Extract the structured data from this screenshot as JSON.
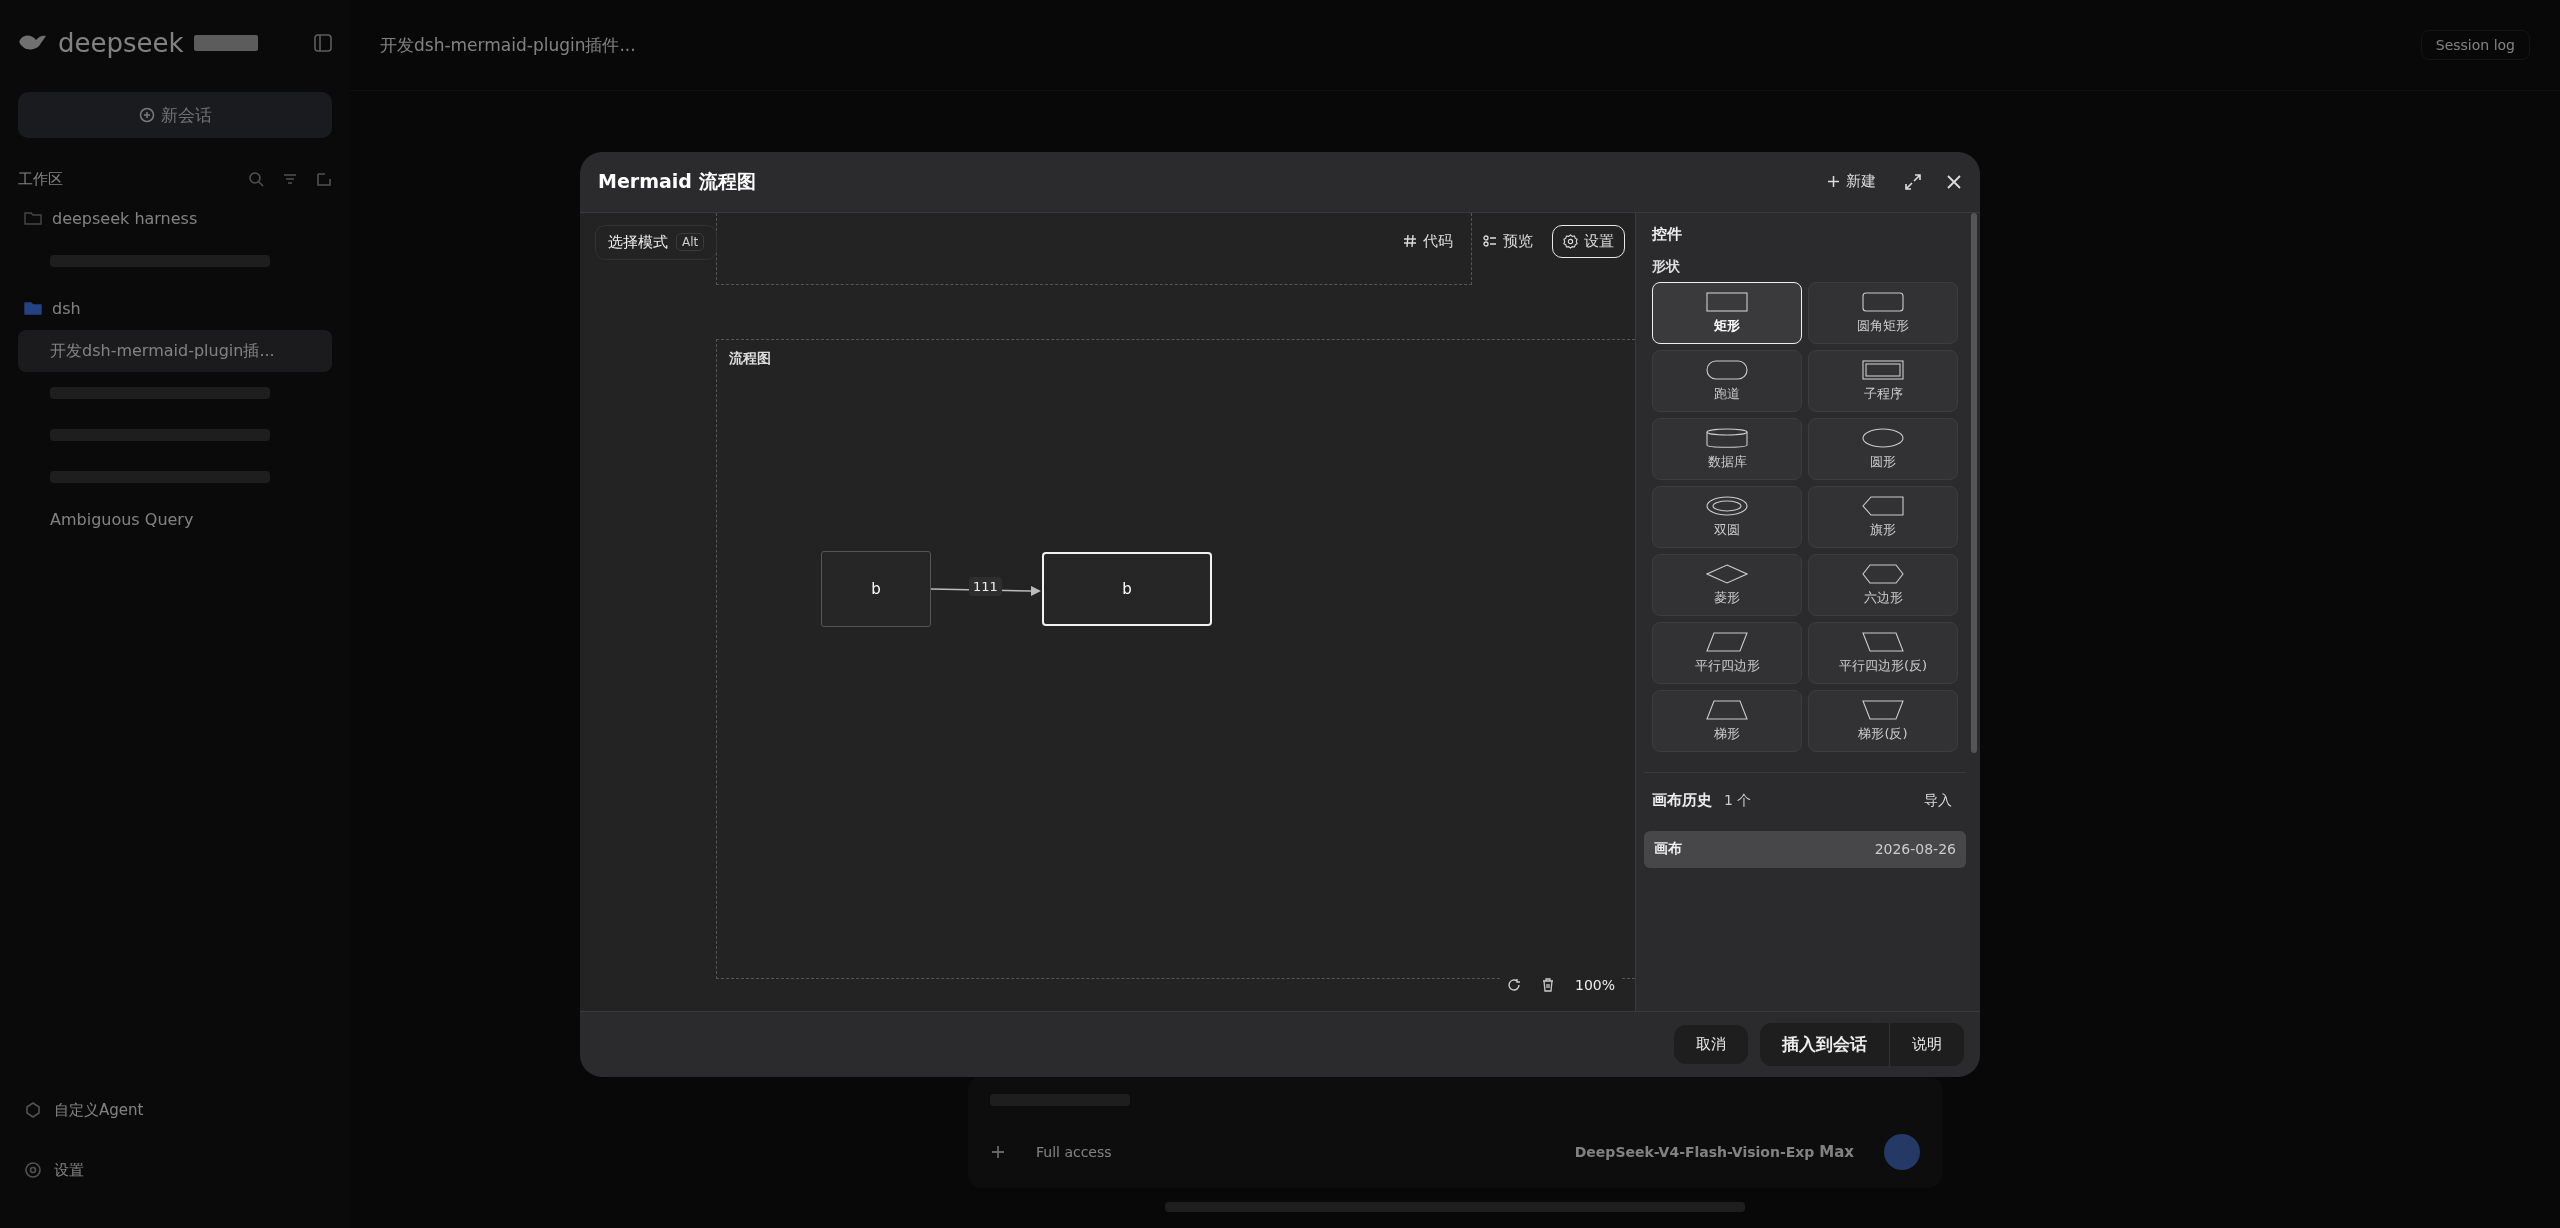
{
  "app": {
    "brand": "deepseek",
    "new_chat": "新会话",
    "workspace_label": "工作区",
    "folders": [
      {
        "name": "deepseek harness",
        "active": false,
        "sessions": [
          {
            "kind": "blurred",
            "selected": false
          }
        ]
      },
      {
        "name": "dsh",
        "active": true,
        "sessions": [
          {
            "kind": "text",
            "title": "开发dsh-mermaid-plugin插...",
            "selected": true
          },
          {
            "kind": "blurred",
            "selected": false
          },
          {
            "kind": "blurred",
            "selected": false
          },
          {
            "kind": "blurred",
            "selected": false
          },
          {
            "kind": "text",
            "title": "Ambiguous Query",
            "selected": false
          }
        ]
      }
    ],
    "footer_items": [
      {
        "kind": "agent",
        "label": "自定义Agent"
      },
      {
        "kind": "settings",
        "label": "设置"
      }
    ],
    "topbar": {
      "title": "开发dsh-mermaid-plugin插件...",
      "session_log": "Session log"
    },
    "composer": {
      "access": "Full access",
      "model": "DeepSeek-V4-Flash-Vision-Exp",
      "effort": "Max"
    }
  },
  "dialog": {
    "title": "Mermaid 流程图",
    "new_button": "新建",
    "mode_chip": {
      "label": "选择模式",
      "shortcut": "Alt"
    },
    "view_buttons": [
      {
        "kind": "code",
        "label": "代码",
        "selected": false
      },
      {
        "kind": "preview",
        "label": "预览",
        "selected": false
      },
      {
        "kind": "settings",
        "label": "设置",
        "selected": true
      }
    ],
    "subgraph": {
      "label": "流程图",
      "nodes": [
        {
          "label": "b",
          "selected": false
        },
        {
          "label": "b",
          "selected": true
        }
      ],
      "edges": [
        {
          "label": "111"
        }
      ]
    },
    "zoom": "100%",
    "panel": {
      "title": "控件",
      "shapes_label": "形状",
      "shapes": [
        {
          "kind": "rect",
          "label": "矩形",
          "selected": true
        },
        {
          "kind": "round",
          "label": "圆角矩形",
          "selected": false
        },
        {
          "kind": "stadium",
          "label": "跑道",
          "selected": false
        },
        {
          "kind": "subroutine",
          "label": "子程序",
          "selected": false
        },
        {
          "kind": "database",
          "label": "数据库",
          "selected": false
        },
        {
          "kind": "circle",
          "label": "圆形",
          "selected": false
        },
        {
          "kind": "double-circle",
          "label": "双圆",
          "selected": false
        },
        {
          "kind": "flag",
          "label": "旗形",
          "selected": false
        },
        {
          "kind": "diamond",
          "label": "菱形",
          "selected": false
        },
        {
          "kind": "hexagon",
          "label": "六边形",
          "selected": false
        },
        {
          "kind": "parallelogram",
          "label": "平行四边形",
          "selected": false
        },
        {
          "kind": "parallelogram-alt",
          "label": "平行四边形(反)",
          "selected": false
        },
        {
          "kind": "trapezoid",
          "label": "梯形",
          "selected": false
        },
        {
          "kind": "trapezoid-alt",
          "label": "梯形(反)",
          "selected": false
        }
      ]
    },
    "history": {
      "title": "画布历史",
      "count": "1 个",
      "import": "导入",
      "items": [
        {
          "name": "画布",
          "date": "2026-08-26",
          "selected": true
        }
      ]
    },
    "footer": {
      "cancel": "取消",
      "insert": "插入到会话",
      "help": "说明"
    }
  }
}
